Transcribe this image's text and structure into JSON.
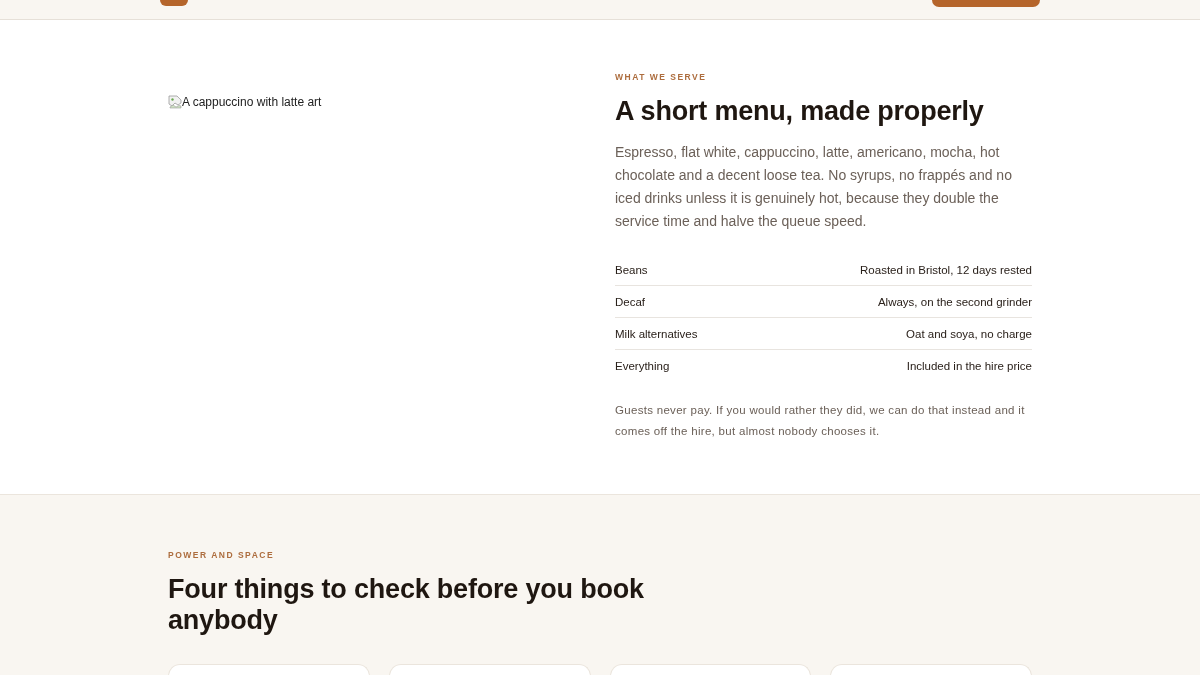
{
  "menu_section": {
    "image": {
      "alt": "A cappuccino with latte art"
    },
    "eyebrow": "WHAT WE SERVE",
    "heading": "A short menu, made properly",
    "body": "Espresso, flat white, cappuccino, latte, americano, mocha, hot chocolate and a decent loose tea. No syrups, no frappés and no iced drinks unless it is genuinely hot, because they double the service time and halve the queue speed.",
    "details": [
      {
        "label": "Beans",
        "value": "Roasted in Bristol, 12 days rested"
      },
      {
        "label": "Decaf",
        "value": "Always, on the second grinder"
      },
      {
        "label": "Milk alternatives",
        "value": "Oat and soya, no charge"
      },
      {
        "label": "Everything",
        "value": "Included in the hire price"
      }
    ],
    "note": "Guests never pay. If you would rather they did, we can do that instead and it comes off the hire, but almost nobody chooses it."
  },
  "power_section": {
    "eyebrow": "POWER AND SPACE",
    "heading": "Four things to check before you book anybody"
  }
}
